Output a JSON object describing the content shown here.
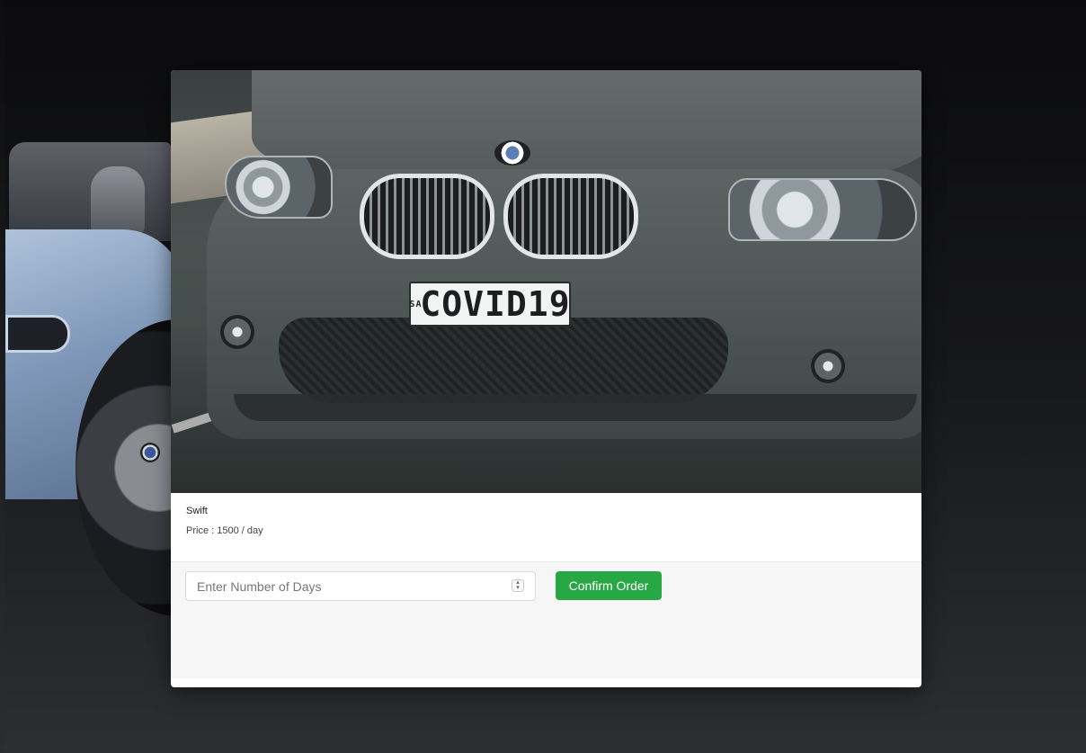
{
  "car": {
    "name": "Swift",
    "price_text": "Price : 1500 / day",
    "plate_prefix": "SA",
    "plate_text": "COVID19"
  },
  "order": {
    "days_placeholder": "Enter Number of Days",
    "days_value": "",
    "confirm_label": "Confirm Order"
  },
  "icons": {
    "stepper": "up-down-stepper-icon"
  },
  "colors": {
    "confirm_button": "#28a745",
    "footer_bg": "#f6f6f6",
    "page_bg": "#1a1b1e"
  }
}
